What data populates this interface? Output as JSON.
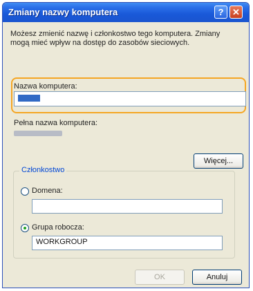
{
  "window": {
    "title": "Zmiany nazwy komputera",
    "help_glyph": "?",
    "close_glyph": "✕"
  },
  "description": "Możesz zmienić nazwę i członkostwo tego komputera. Zmiany mogą mieć wpływ na dostęp do zasobów sieciowych.",
  "computer_name": {
    "label": "Nazwa komputera:"
  },
  "full_name": {
    "label": "Pełna nazwa komputera:"
  },
  "more_button": "Więcej...",
  "membership": {
    "legend": "Członkostwo",
    "domain_label": "Domena:",
    "domain_value": "",
    "workgroup_label": "Grupa robocza:",
    "workgroup_value": "WORKGROUP",
    "selected": "workgroup"
  },
  "ok_button": "OK",
  "cancel_button": "Anuluj",
  "colors": {
    "highlight": "#f5a623",
    "titlebar": "#1958d8",
    "legend": "#0046d5"
  }
}
